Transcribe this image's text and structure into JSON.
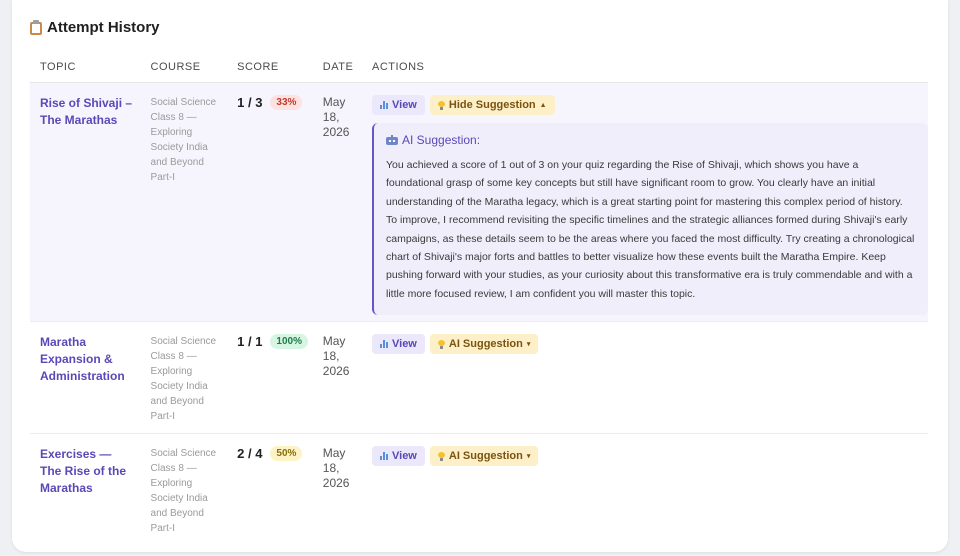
{
  "card": {
    "title": "Attempt History",
    "title_icon": "clipboard-icon"
  },
  "table": {
    "headers": [
      "TOPIC",
      "COURSE",
      "SCORE",
      "DATE",
      "ACTIONS"
    ],
    "rows": [
      {
        "topic": "Rise of Shivaji – The Marathas",
        "course": "Social Science Class 8 — Exploring Society India and Beyond Part-I",
        "score": "1 / 3",
        "percent": "33%",
        "date": "May 18, 2026",
        "view_label": "View",
        "suggestion_label": "Hide Suggestion",
        "suggestion_caret": "▲",
        "expanded": true,
        "suggestion": {
          "title": "AI Suggestion:",
          "text": "You achieved a score of 1 out of 3 on your quiz regarding the Rise of Shivaji, which shows you have a foundational grasp of some key concepts but still have significant room to grow. You clearly have an initial understanding of the Maratha legacy, which is a great starting point for mastering this complex period of history. To improve, I recommend revisiting the specific timelines and the strategic alliances formed during Shivaji's early campaigns, as these details seem to be the areas where you faced the most difficulty. Try creating a chronological chart of Shivaji's major forts and battles to better visualize how these events built the Maratha Empire. Keep pushing forward with your studies, as your curiosity about this transformative era is truly commendable and with a little more focused review, I am confident you will master this topic."
        }
      },
      {
        "topic": "Maratha Expansion & Administration",
        "course": "Social Science Class 8 — Exploring Society India and Beyond Part-I",
        "score": "1 / 1",
        "percent": "100%",
        "date": "May 18, 2026",
        "view_label": "View",
        "suggestion_label": "AI Suggestion",
        "suggestion_caret": "▾",
        "expanded": false
      },
      {
        "topic": "Exercises — The Rise of the Marathas",
        "course": "Social Science Class 8 — Exploring Society India and Beyond Part-I",
        "score": "2 / 4",
        "percent": "50%",
        "date": "May 18, 2026",
        "view_label": "View",
        "suggestion_label": "AI Suggestion",
        "suggestion_caret": "▾",
        "expanded": false
      }
    ]
  },
  "colors": {
    "accent": "#5b48b8",
    "pill_red": "#fde2e2",
    "pill_green": "#d6f5e3",
    "pill_yellow": "#fdf3c4",
    "suggestion_bg": "#f0eefb"
  }
}
